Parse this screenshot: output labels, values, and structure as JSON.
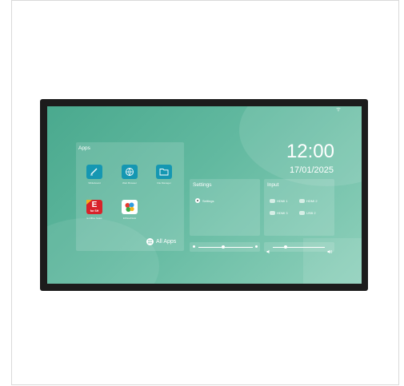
{
  "screen": {
    "time": "12:00",
    "date": "17/01/2025"
  },
  "apps": {
    "title": "Apps",
    "items": [
      {
        "label": "Whiteboard",
        "icon": "pen-icon"
      },
      {
        "label": "Web Browser",
        "icon": "globe-icon"
      },
      {
        "label": "File Manager",
        "icon": "folder-icon"
      },
      {
        "label": "E-Office Sales",
        "icon": "eoffice-logo-icon",
        "logo_text": "E",
        "badge_text": "for SH"
      },
      {
        "label": "EShowDesk",
        "icon": "multicolor-dots-icon"
      }
    ],
    "all_apps_label": "All Apps"
  },
  "settings": {
    "title": "Settings",
    "item_label": "Settings"
  },
  "input": {
    "title": "Input",
    "sources": [
      "HDMI 1",
      "HDMI 2",
      "HDMI 3",
      "USB 2"
    ]
  },
  "sliders": {
    "brightness_level": 0.45,
    "volume_level": 0.25
  },
  "colors": {
    "screen_bg": "#5db49a",
    "app_icon_blue": "#1597b2",
    "eoffice_red": "#d8232a",
    "bezel": "#1c1c1c"
  }
}
